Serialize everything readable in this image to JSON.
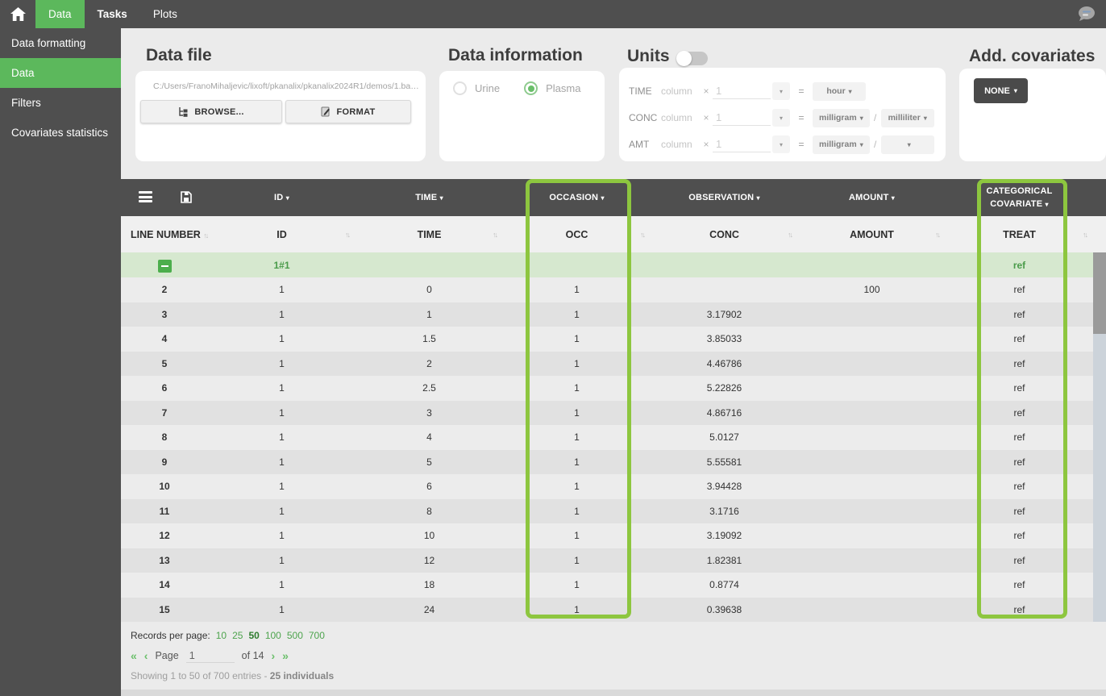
{
  "topnav": {
    "tabs": [
      {
        "label": "Data",
        "active": true
      },
      {
        "label": "Tasks",
        "active": false
      },
      {
        "label": "Plots",
        "active": false
      }
    ]
  },
  "sidebar": {
    "items": [
      {
        "label": "Data formatting",
        "active": false
      },
      {
        "label": "Data",
        "active": true
      },
      {
        "label": "Filters",
        "active": false
      },
      {
        "label": "Covariates statistics",
        "active": false
      }
    ]
  },
  "panels": {
    "data_file": {
      "title": "Data file",
      "path": "C:/Users/FranoMihaljevic/lixoft/pkanalix/pkanalix2024R1/demos/1.ba…",
      "browse_label": "BROWSE...",
      "format_label": "FORMAT"
    },
    "data_information": {
      "title": "Data information",
      "urine_label": "Urine",
      "plasma_label": "Plasma",
      "selected": "Plasma"
    },
    "units": {
      "title": "Units",
      "toggle_on": false,
      "rows": [
        {
          "label": "TIME",
          "column_text": "column",
          "times": "×",
          "factor_placeholder": "1",
          "equals": "=",
          "unit1": "hour"
        },
        {
          "label": "CONC",
          "column_text": "column",
          "times": "×",
          "factor_placeholder": "1",
          "equals": "=",
          "unit1": "milligram",
          "slash": "/",
          "unit2": "milliliter"
        },
        {
          "label": "AMT",
          "column_text": "column",
          "times": "×",
          "factor_placeholder": "1",
          "equals": "=",
          "unit1": "milligram",
          "slash": "/",
          "unit2": ""
        }
      ]
    },
    "add_covariates": {
      "title": "Add. covariates",
      "button_label": "NONE"
    }
  },
  "table": {
    "header_groups": [
      "ID",
      "TIME",
      "OCCASION",
      "OBSERVATION",
      "AMOUNT",
      "CATEGORICAL COVARIATE"
    ],
    "columns": [
      "LINE NUMBER",
      "ID",
      "TIME",
      "OCC",
      "CONC",
      "AMOUNT",
      "TREAT"
    ],
    "group_row": {
      "id": "1#1",
      "treat": "ref"
    },
    "rows": [
      {
        "line": "2",
        "id": "1",
        "time": "0",
        "occ": "1",
        "conc": "",
        "amount": "100",
        "treat": "ref"
      },
      {
        "line": "3",
        "id": "1",
        "time": "1",
        "occ": "1",
        "conc": "3.17902",
        "amount": "",
        "treat": "ref"
      },
      {
        "line": "4",
        "id": "1",
        "time": "1.5",
        "occ": "1",
        "conc": "3.85033",
        "amount": "",
        "treat": "ref"
      },
      {
        "line": "5",
        "id": "1",
        "time": "2",
        "occ": "1",
        "conc": "4.46786",
        "amount": "",
        "treat": "ref"
      },
      {
        "line": "6",
        "id": "1",
        "time": "2.5",
        "occ": "1",
        "conc": "5.22826",
        "amount": "",
        "treat": "ref"
      },
      {
        "line": "7",
        "id": "1",
        "time": "3",
        "occ": "1",
        "conc": "4.86716",
        "amount": "",
        "treat": "ref"
      },
      {
        "line": "8",
        "id": "1",
        "time": "4",
        "occ": "1",
        "conc": "5.0127",
        "amount": "",
        "treat": "ref"
      },
      {
        "line": "9",
        "id": "1",
        "time": "5",
        "occ": "1",
        "conc": "5.55581",
        "amount": "",
        "treat": "ref"
      },
      {
        "line": "10",
        "id": "1",
        "time": "6",
        "occ": "1",
        "conc": "3.94428",
        "amount": "",
        "treat": "ref"
      },
      {
        "line": "11",
        "id": "1",
        "time": "8",
        "occ": "1",
        "conc": "3.1716",
        "amount": "",
        "treat": "ref"
      },
      {
        "line": "12",
        "id": "1",
        "time": "10",
        "occ": "1",
        "conc": "3.19092",
        "amount": "",
        "treat": "ref"
      },
      {
        "line": "13",
        "id": "1",
        "time": "12",
        "occ": "1",
        "conc": "1.82381",
        "amount": "",
        "treat": "ref"
      },
      {
        "line": "14",
        "id": "1",
        "time": "18",
        "occ": "1",
        "conc": "0.8774",
        "amount": "",
        "treat": "ref"
      },
      {
        "line": "15",
        "id": "1",
        "time": "24",
        "occ": "1",
        "conc": "0.39638",
        "amount": "",
        "treat": "ref"
      }
    ]
  },
  "pagination": {
    "records_label": "Records per page:",
    "options": [
      "10",
      "25",
      "50",
      "100",
      "500",
      "700"
    ],
    "selected": "50",
    "first": "«",
    "prev": "‹",
    "page_label": "Page",
    "page_value": "1",
    "of_label": "of 14",
    "next": "›",
    "last": "»",
    "showing_text": "Showing 1 to 50 of 700 entries - ",
    "individuals_text": "25 individuals"
  },
  "colors": {
    "accent_green": "#5cb85c",
    "highlight_green": "#8dc63f",
    "dark_gray": "#4f4f4f"
  }
}
